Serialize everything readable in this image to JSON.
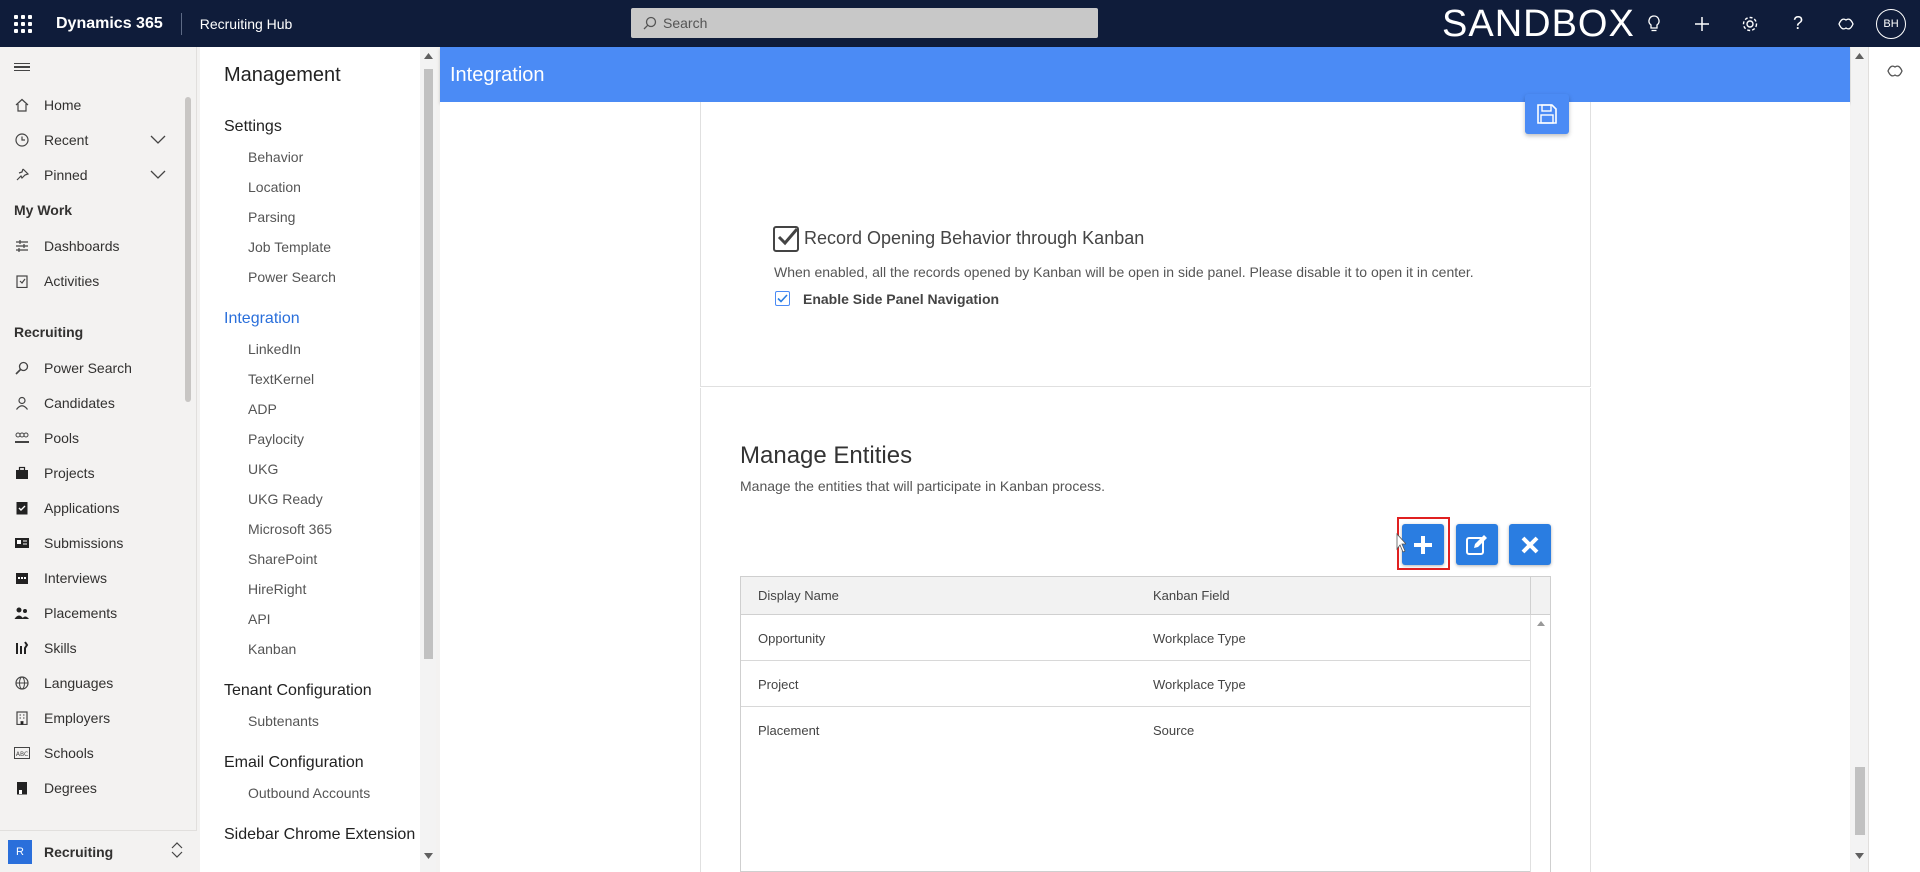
{
  "topbar": {
    "brand": "Dynamics 365",
    "app_title": "Recruiting Hub",
    "search_placeholder": "Search",
    "environment_label": "SANDBOX",
    "avatar_initials": "BH"
  },
  "leftnav": {
    "items_top": [
      {
        "label": "Home",
        "icon": "home-icon"
      },
      {
        "label": "Recent",
        "icon": "clock-icon"
      },
      {
        "label": "Pinned",
        "icon": "pin-icon"
      }
    ],
    "my_work_heading": "My Work",
    "my_work_items": [
      {
        "label": "Dashboards",
        "icon": "dashboard-icon"
      },
      {
        "label": "Activities",
        "icon": "clipboard-icon"
      }
    ],
    "recruiting_heading": "Recruiting",
    "recruiting_items": [
      {
        "label": "Power Search",
        "icon": "search-icon"
      },
      {
        "label": "Candidates",
        "icon": "person-icon"
      },
      {
        "label": "Pools",
        "icon": "group-icon"
      },
      {
        "label": "Projects",
        "icon": "briefcase-icon"
      },
      {
        "label": "Applications",
        "icon": "check-doc-icon"
      },
      {
        "label": "Submissions",
        "icon": "contact-card-icon"
      },
      {
        "label": "Interviews",
        "icon": "calendar-icon"
      },
      {
        "label": "Placements",
        "icon": "people-icon"
      },
      {
        "label": "Skills",
        "icon": "skills-icon"
      },
      {
        "label": "Languages",
        "icon": "globe-icon"
      },
      {
        "label": "Employers",
        "icon": "building-icon"
      },
      {
        "label": "Schools",
        "icon": "abc-icon"
      },
      {
        "label": "Degrees",
        "icon": "book-icon"
      }
    ],
    "area": {
      "badge": "R",
      "label": "Recruiting"
    }
  },
  "management": {
    "title": "Management",
    "settings": {
      "label": "Settings",
      "items": [
        "Behavior",
        "Location",
        "Parsing",
        "Job Template",
        "Power Search"
      ]
    },
    "integration": {
      "label": "Integration",
      "items": [
        "LinkedIn",
        "TextKernel",
        "ADP",
        "Paylocity",
        "UKG",
        "UKG Ready",
        "Microsoft 365",
        "SharePoint",
        "HireRight",
        "API",
        "Kanban"
      ]
    },
    "tenant": {
      "label": "Tenant Configuration",
      "items": [
        "Subtenants"
      ]
    },
    "email": {
      "label": "Email Configuration",
      "items": [
        "Outbound Accounts"
      ]
    },
    "sidebar_ext": {
      "label": "Sidebar Chrome Extension"
    }
  },
  "page": {
    "header": "Integration",
    "record_opening": {
      "label": "Record Opening Behavior through Kanban",
      "description": "When enabled, all the records opened by Kanban will be open in side panel. Please disable it to open it in center.",
      "checkbox_label": "Enable Side Panel Navigation",
      "checked": true
    },
    "manage_entities": {
      "title": "Manage Entities",
      "description": "Manage the entities that will participate in Kanban process.",
      "columns": [
        "Display Name",
        "Kanban Field"
      ],
      "rows": [
        {
          "display_name": "Opportunity",
          "kanban_field": "Workplace Type"
        },
        {
          "display_name": "Project",
          "kanban_field": "Workplace Type"
        },
        {
          "display_name": "Placement",
          "kanban_field": "Source"
        }
      ]
    }
  },
  "colors": {
    "topbar": "#0f1c3a",
    "header_blue": "#4b8bf5",
    "action_blue": "#2a7de1",
    "highlight_red": "#e02020",
    "active_link": "#2a6fdb"
  }
}
